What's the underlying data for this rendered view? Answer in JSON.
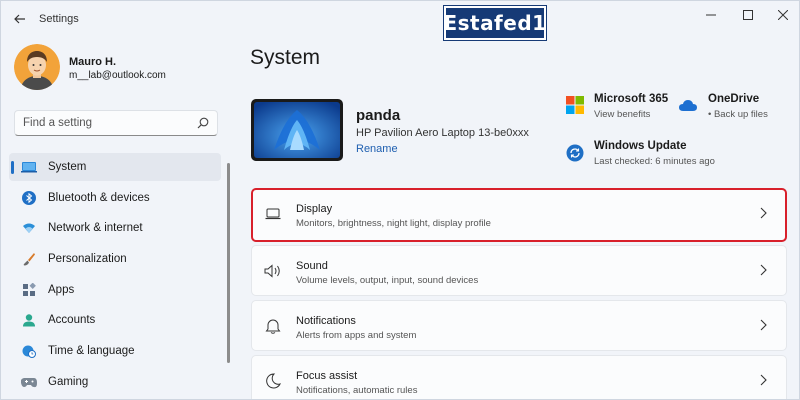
{
  "window": {
    "title": "Settings",
    "watermark": "Estafed1"
  },
  "profile": {
    "name": "Mauro H.",
    "email": "m__lab@outlook.com"
  },
  "search": {
    "placeholder": "Find a setting"
  },
  "sidebar": {
    "items": [
      {
        "label": "System",
        "icon": "laptop-icon",
        "active": true
      },
      {
        "label": "Bluetooth & devices",
        "icon": "bluetooth-icon"
      },
      {
        "label": "Network & internet",
        "icon": "wifi-icon"
      },
      {
        "label": "Personalization",
        "icon": "brush-icon"
      },
      {
        "label": "Apps",
        "icon": "apps-icon"
      },
      {
        "label": "Accounts",
        "icon": "person-icon"
      },
      {
        "label": "Time & language",
        "icon": "globe-clock-icon"
      },
      {
        "label": "Gaming",
        "icon": "gamepad-icon"
      }
    ]
  },
  "main": {
    "title": "System",
    "device": {
      "name": "panda",
      "model": "HP Pavilion Aero Laptop 13-be0xxx",
      "rename": "Rename"
    },
    "tiles": [
      {
        "title": "Microsoft 365",
        "subtitle": "View benefits",
        "icon": "microsoft-logo-icon"
      },
      {
        "title": "OneDrive",
        "subtitle": "Back up files",
        "icon": "cloud-icon"
      },
      {
        "title": "Windows Update",
        "subtitle": "Last checked: 6 minutes ago",
        "icon": "update-icon"
      }
    ],
    "cards": [
      {
        "title": "Display",
        "subtitle": "Monitors, brightness, night light, display profile",
        "icon": "monitor-icon",
        "highlighted": true
      },
      {
        "title": "Sound",
        "subtitle": "Volume levels, output, input, sound devices",
        "icon": "speaker-icon"
      },
      {
        "title": "Notifications",
        "subtitle": "Alerts from apps and system",
        "icon": "bell-icon"
      },
      {
        "title": "Focus assist",
        "subtitle": "Notifications, automatic rules",
        "icon": "moon-icon"
      }
    ]
  },
  "colors": {
    "accent": "#1f6fc5",
    "highlight_border": "#d8202b",
    "watermark_bg": "#163a76"
  }
}
